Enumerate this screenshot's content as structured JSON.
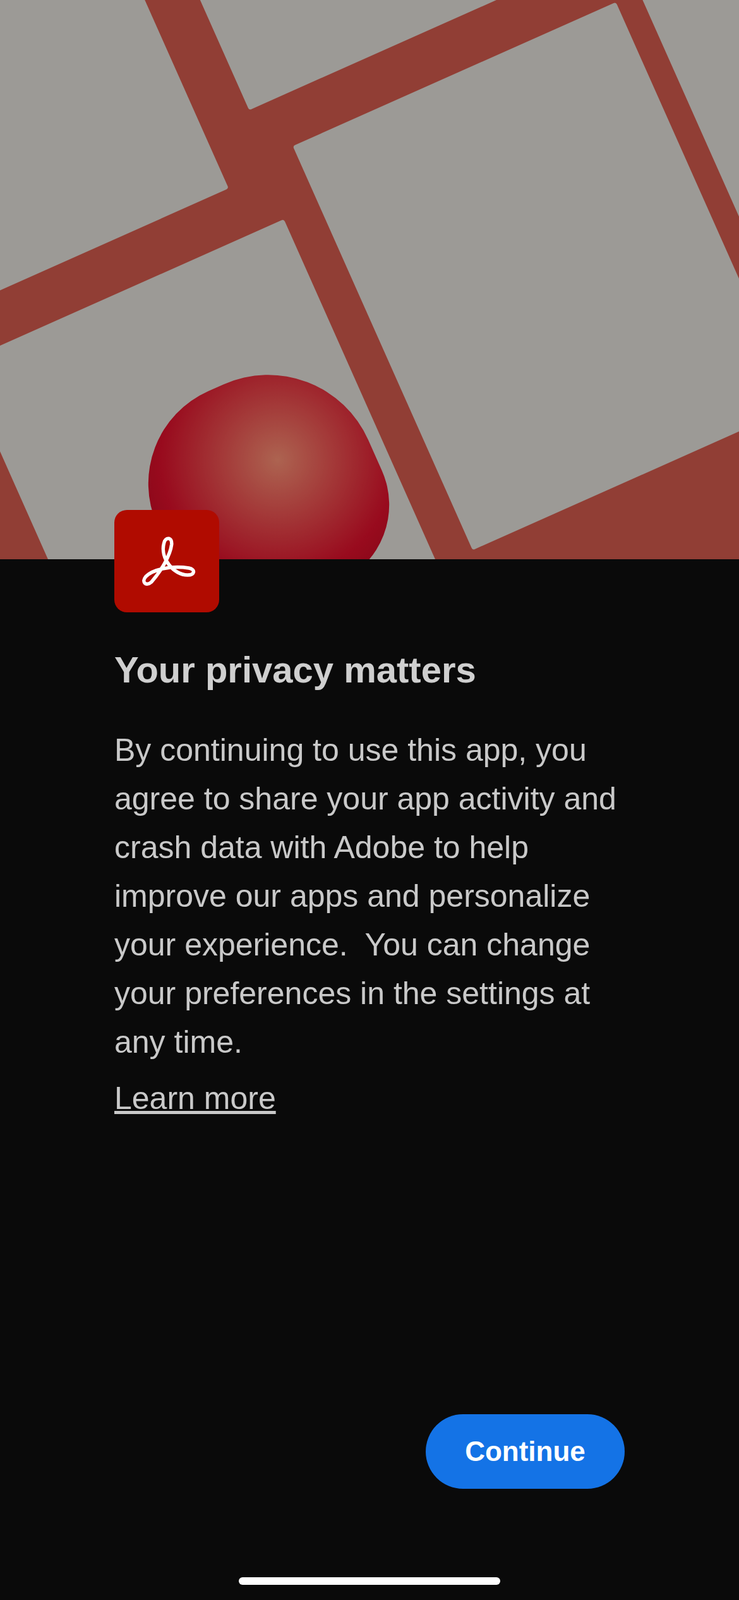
{
  "screen": {
    "title": "Your privacy matters",
    "body": "By continuing to use this app, you agree to share your app activity and crash data with Adobe to help improve our apps and personalize your experience.  You can change your preferences in the settings at any time.",
    "link": "Learn more"
  },
  "buttons": [
    "Continue"
  ]
}
